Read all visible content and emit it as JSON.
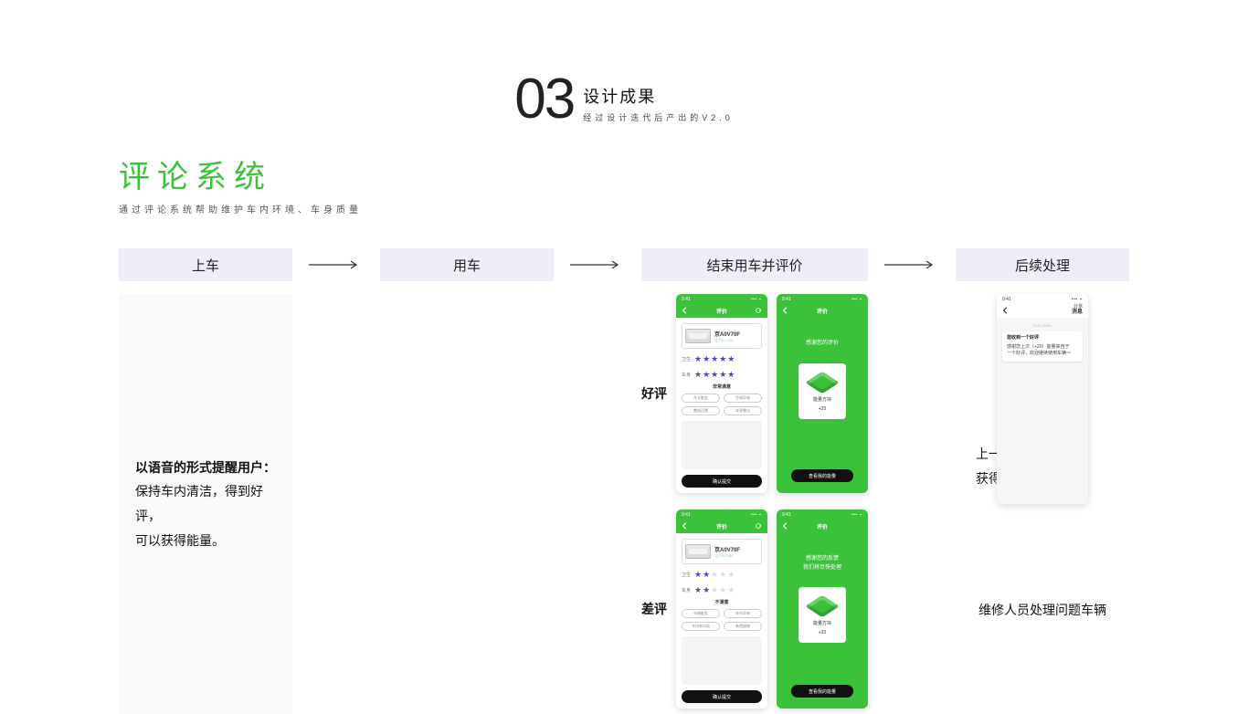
{
  "header": {
    "number": "03",
    "title": "设计成果",
    "subtitle": "经过设计迭代后产出的V2.0"
  },
  "section": {
    "title": "评论系统",
    "subtitle": "通过评论系统帮助维护车内环境、车身质量"
  },
  "flow": [
    "上车",
    "用车",
    "结束用车并评价",
    "后续处理"
  ],
  "column1": {
    "heading": "以语音的形式提醒用户：",
    "line1": "保持车内清洁，得到好评，",
    "line2": "可以获得能量。"
  },
  "column3": {
    "good_label": "好评",
    "bad_label": "差评",
    "phone_time": "9:41",
    "rate_header": "评价",
    "car_plate": "京A0V70F",
    "car_model": "北汽EC180",
    "row_hygiene": "卫生",
    "row_body": "车身",
    "satisfy_good": "非常满意",
    "satisfy_bad": "不满意",
    "tags_good": [
      "车太脏乱",
      "空调异味",
      "整体还需",
      "车身整洁"
    ],
    "tags_bad": [
      "车辆脏乱",
      "车内异味",
      "车内有垃圾",
      "有遗留物"
    ],
    "submit": "确认提交",
    "thank_good": "感谢您的评价",
    "thank_bad_1": "感谢您的反馈",
    "thank_bad_2": "我们将尽快处理",
    "energy_name": "能量方块",
    "energy_value": "+20",
    "view_btn": "查看我的能量"
  },
  "column4": {
    "msg_header": "消息",
    "msg_tab": "分享",
    "msg_date": "9-12 15:53",
    "msg_title": "您收到一个好评",
    "msg_body_1": "感谢您上次（+20）能量来自于",
    "msg_body_2": "一个好评，欢迎继续使用车辆～",
    "good_text_1": "上一位用车者",
    "good_text_2": "获得能量奖励",
    "bad_text": "维修人员处理问题车辆"
  }
}
